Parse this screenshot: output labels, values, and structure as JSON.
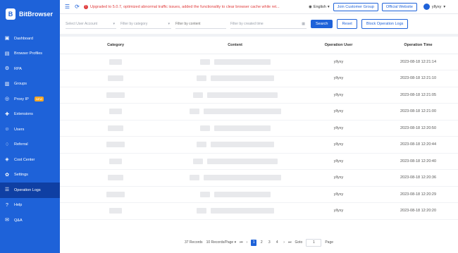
{
  "sidebar": {
    "brand": "BitBrowser",
    "items": [
      {
        "label": "Dashboard",
        "icon": "dashboard-icon"
      },
      {
        "label": "Browser Profiles",
        "icon": "browser-icon"
      },
      {
        "label": "RPA",
        "icon": "rpa-icon"
      },
      {
        "label": "Groups",
        "icon": "groups-icon"
      },
      {
        "label": "Proxy IP",
        "icon": "proxy-icon",
        "badge": "NEW"
      },
      {
        "label": "Extensions",
        "icon": "extensions-icon"
      },
      {
        "label": "Users",
        "icon": "users-icon"
      },
      {
        "label": "Referral",
        "icon": "referral-icon"
      },
      {
        "label": "Cost Center",
        "icon": "cost-icon"
      },
      {
        "label": "Settings",
        "icon": "settings-icon"
      },
      {
        "label": "Operation Logs",
        "icon": "logs-icon",
        "active": true
      },
      {
        "label": "Help",
        "icon": "help-icon"
      },
      {
        "label": "Q&A",
        "icon": "qa-icon"
      }
    ]
  },
  "topbar": {
    "notice": "Upgraded to 5.0.7, optimized abnormal traffic issues, added the functionality to clear browser cache while ret...",
    "language": "English",
    "join_group": "Join Customer Group",
    "official_site": "Official Website",
    "username": "yllyxy"
  },
  "filters": {
    "user_account": "Select User Account",
    "category": "Filter by category",
    "content": "Filter by content",
    "created_time": "Filter by created time",
    "search": "Search",
    "reset": "Reset",
    "block_logs": "Block Operation Logs"
  },
  "table": {
    "headers": [
      "Category",
      "Content",
      "Operation User",
      "Operation Time"
    ],
    "rows": [
      {
        "user": "yllyxy",
        "time": "2023-08-18 12:21:14"
      },
      {
        "user": "yllyxy",
        "time": "2023-08-18 12:21:10"
      },
      {
        "user": "yllyxy",
        "time": "2023-08-18 12:21:05"
      },
      {
        "user": "yllyxy",
        "time": "2023-08-18 12:21:00"
      },
      {
        "user": "yllyxy",
        "time": "2023-08-18 12:20:50"
      },
      {
        "user": "yllyxy",
        "time": "2023-08-18 12:20:44"
      },
      {
        "user": "yllyxy",
        "time": "2023-08-18 12:20:40"
      },
      {
        "user": "yllyxy",
        "time": "2023-08-18 12:20:36"
      },
      {
        "user": "yllyxy",
        "time": "2023-08-18 12:20:29"
      },
      {
        "user": "yllyxy",
        "time": "2023-08-18 12:20:20"
      }
    ]
  },
  "pagination": {
    "records": "37 Records",
    "per_page": "10 Records/Page",
    "pages": [
      "1",
      "2",
      "3",
      "4"
    ],
    "current": "1",
    "goto_label": "Goto",
    "goto_value": "1",
    "page_label": "Page"
  },
  "colors": {
    "primary": "#1e62d9",
    "notice": "#e03b3b"
  }
}
